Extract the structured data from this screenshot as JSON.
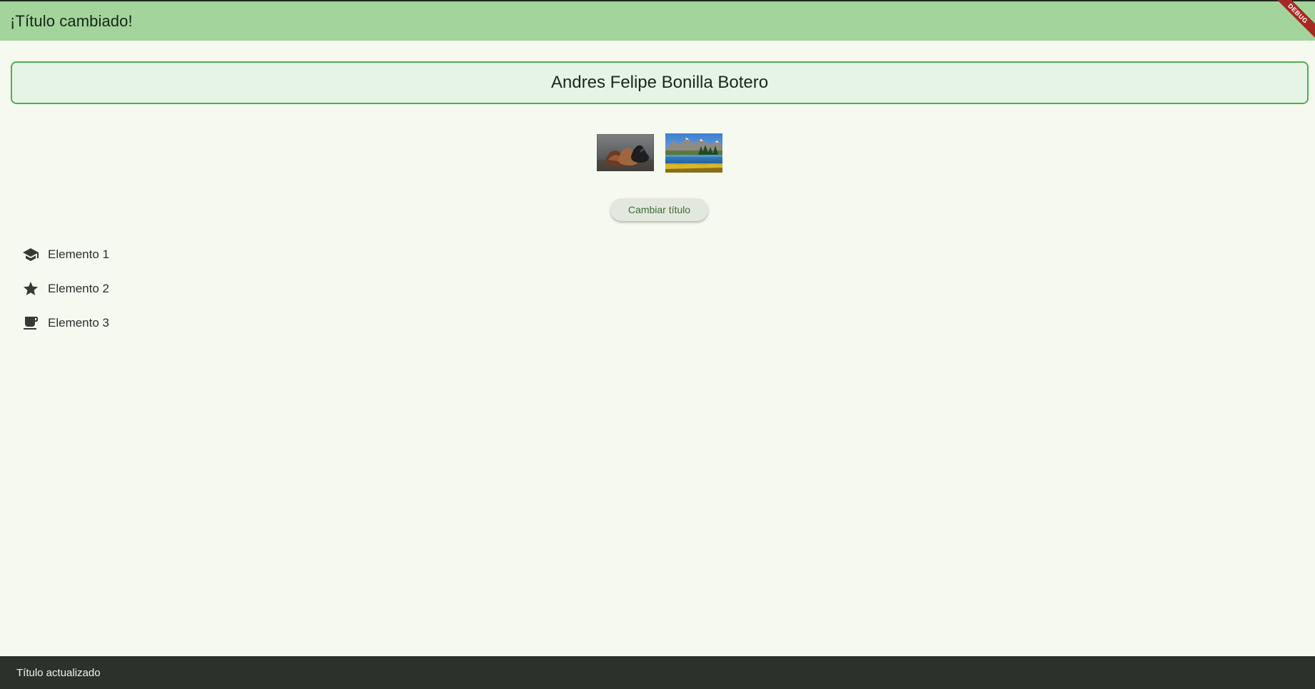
{
  "app_bar": {
    "title": "¡Título cambiado!"
  },
  "debug_banner": {
    "label": "DEBUG"
  },
  "name_card": {
    "text": "Andres Felipe Bonilla Botero"
  },
  "images": [
    {
      "name": "shoes-image"
    },
    {
      "name": "landscape-image"
    }
  ],
  "change_button": {
    "label": "Cambiar título"
  },
  "list": {
    "items": [
      {
        "label": "Elemento 1",
        "icon": "school-icon"
      },
      {
        "label": "Elemento 2",
        "icon": "star-icon"
      },
      {
        "label": "Elemento 3",
        "icon": "coffee-icon"
      }
    ]
  },
  "snackbar": {
    "text": "Título actualizado"
  },
  "colors": {
    "app_bar": "#a2d49c",
    "background": "#f6f9f0",
    "card_border": "#4caf50",
    "card_fill": "#e6f4e6",
    "snackbar": "#2d312c",
    "debug": "#a52a22"
  }
}
